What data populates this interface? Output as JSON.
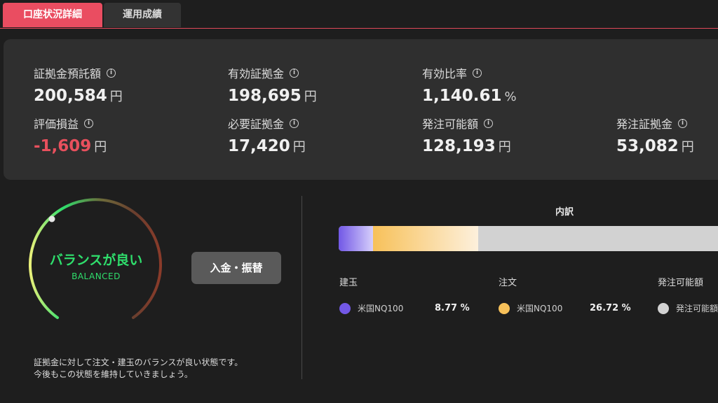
{
  "tabs": [
    {
      "label": "口座状況詳細"
    },
    {
      "label": "運用成績"
    }
  ],
  "info_icon_glyph": "i",
  "metrics": {
    "deposit": {
      "label": "証拠金預託額",
      "value": "200,584",
      "unit": "円"
    },
    "effective_margin": {
      "label": "有効証拠金",
      "value": "198,695",
      "unit": "円"
    },
    "effective_ratio": {
      "label": "有効比率",
      "value": "1,140.61",
      "unit": "%"
    },
    "valuation_pl": {
      "label": "評価損益",
      "value": "-1,609",
      "unit": "円"
    },
    "required_margin": {
      "label": "必要証拠金",
      "value": "17,420",
      "unit": "円"
    },
    "orderable_amount": {
      "label": "発注可能額",
      "value": "128,193",
      "unit": "円"
    },
    "order_margin": {
      "label": "発注証拠金",
      "value": "53,082",
      "unit": "円"
    }
  },
  "gauge": {
    "title": "バランスが良い",
    "subtitle": "BALANCED"
  },
  "deposit_button": "入金・振替",
  "description": {
    "line1": "証拠金に対して注文・建玉のバランスが良い状態です。",
    "line2": "今後もこの状態を維持していきましょう。"
  },
  "breakdown": {
    "title": "内訳",
    "shares": {
      "positions": 8.77,
      "orders": 26.72
    },
    "positions": {
      "heading": "建玉",
      "item": "米国NQ100",
      "pct": "8.77 %"
    },
    "orders": {
      "heading": "注文",
      "item": "米国NQ100",
      "pct": "26.72 %"
    },
    "orderable": {
      "heading": "発注可能額",
      "item": "発注可能額"
    }
  },
  "colors": {
    "accent": "#ea4d61",
    "negative": "#e8505d",
    "balanced": "#2fde6c",
    "positions": "#7258e6",
    "orders": "#f7c15a",
    "orderable": "#d2d2d2"
  }
}
